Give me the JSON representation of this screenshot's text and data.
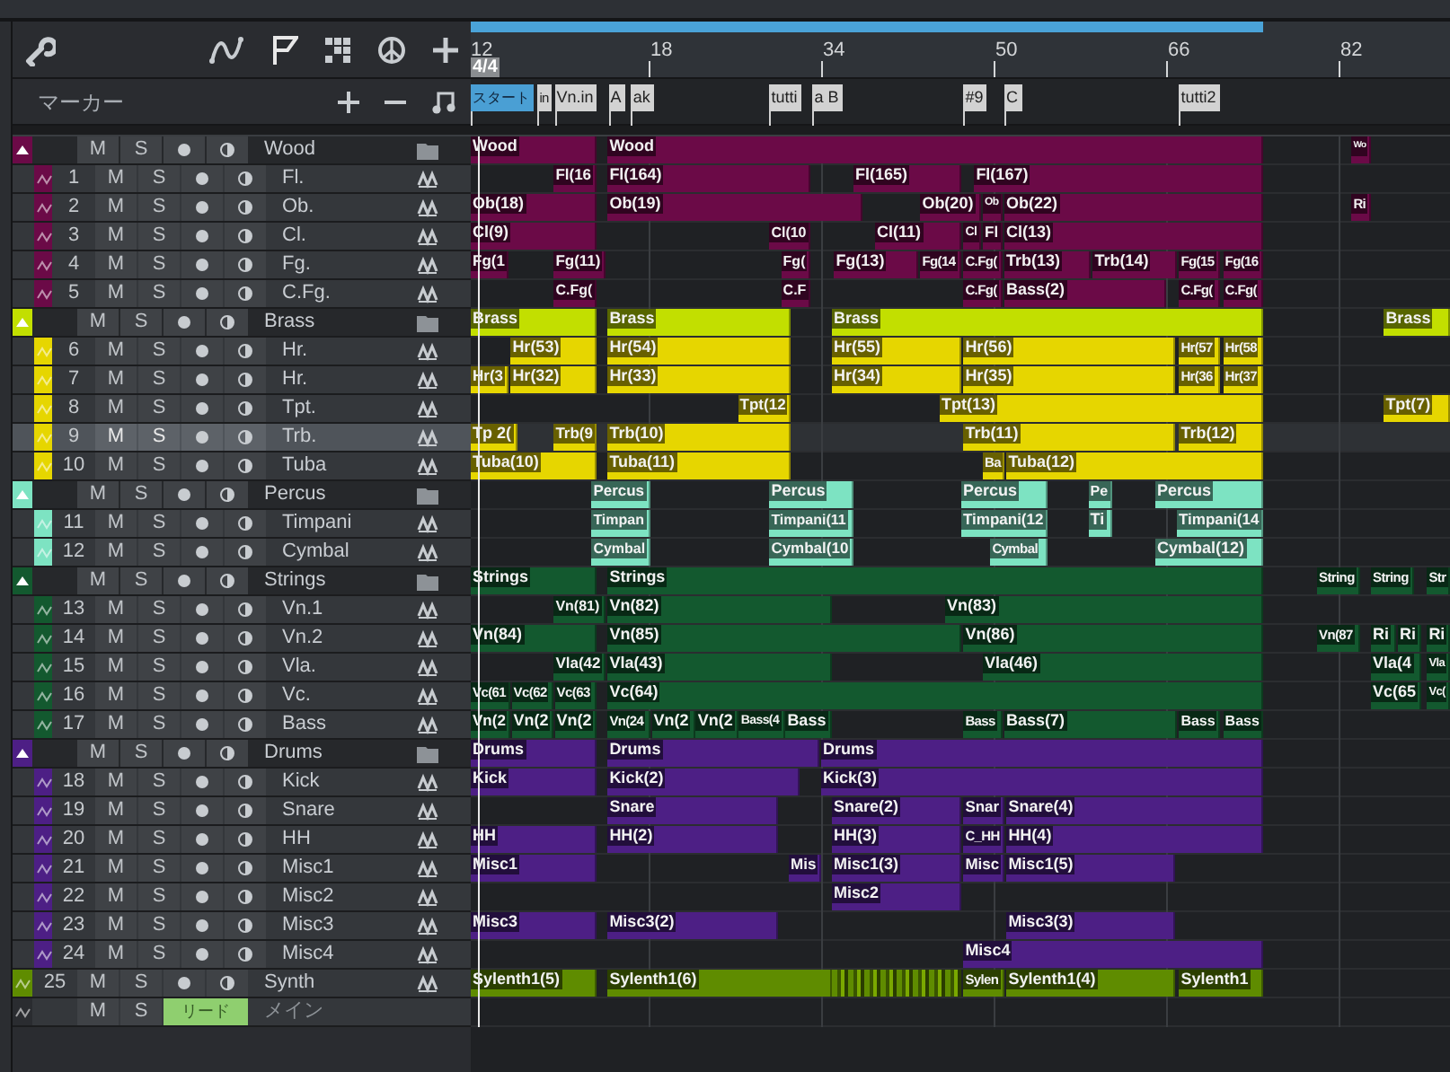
{
  "marker_panel": {
    "title": "マーカー"
  },
  "ruler": {
    "start_label": "12",
    "time_signature": "4/4",
    "ticks": [
      {
        "label": "18"
      },
      {
        "label": "34"
      },
      {
        "label": "50"
      },
      {
        "label": "66"
      },
      {
        "label": "82"
      }
    ]
  },
  "markers": [
    {
      "label": "スタート",
      "selected": true
    },
    {
      "label": "in",
      "selected": false
    },
    {
      "label": "Vn.in",
      "selected": false
    },
    {
      "label": "A",
      "selected": false
    },
    {
      "label": "ak",
      "selected": false
    },
    {
      "label": "tutti",
      "selected": false
    },
    {
      "label": "a B",
      "selected": false
    },
    {
      "label": "#9",
      "selected": false
    },
    {
      "label": "C",
      "selected": false
    },
    {
      "label": "tutti2",
      "selected": false
    }
  ],
  "tracks": [
    {
      "kind": "folder",
      "name": "Wood",
      "color": "#6b0a47",
      "expanded": true,
      "selected": false,
      "mute": "M",
      "solo": "S",
      "clips": [
        "Wood",
        "Wood",
        "Wo"
      ]
    },
    {
      "kind": "track",
      "number": "1",
      "name": "Fl.",
      "color": "#6b0a47",
      "selected": false,
      "mute": "M",
      "solo": "S",
      "clips": [
        "Fl(16",
        "Fl(164)",
        "Fl(165)",
        "Fl(167)"
      ]
    },
    {
      "kind": "track",
      "number": "2",
      "name": "Ob.",
      "color": "#6b0a47",
      "selected": false,
      "mute": "M",
      "solo": "S",
      "clips": [
        "Ob(18)",
        "Ob(19)",
        "Ob(20)",
        "Ob",
        "Ob(22)",
        "Ri"
      ]
    },
    {
      "kind": "track",
      "number": "3",
      "name": "Cl.",
      "color": "#6b0a47",
      "selected": false,
      "mute": "M",
      "solo": "S",
      "clips": [
        "Cl(9)",
        "Cl(10",
        "Cl(11)",
        "Cl",
        "Fl",
        "Cl(13)"
      ]
    },
    {
      "kind": "track",
      "number": "4",
      "name": "Fg.",
      "color": "#6b0a47",
      "selected": false,
      "mute": "M",
      "solo": "S",
      "clips": [
        "Fg(1",
        "Fg(11)",
        "Fg(",
        "Fg(13)",
        "Fg(14",
        "C.Fg(",
        "Trb(13)",
        "Trb(14)",
        "Fg(15",
        "Fg(16"
      ]
    },
    {
      "kind": "track",
      "number": "5",
      "name": "C.Fg.",
      "color": "#6b0a47",
      "selected": false,
      "mute": "M",
      "solo": "S",
      "clips": [
        "C.Fg(",
        "C.F",
        "C.Fg(",
        "Bass(2)",
        "C.Fg(",
        "C.Fg("
      ]
    },
    {
      "kind": "folder",
      "name": "Brass",
      "color": "#c2df00",
      "expanded": true,
      "selected": false,
      "mute": "M",
      "solo": "S",
      "clips": [
        "Brass",
        "Brass",
        "Brass",
        "Brass"
      ]
    },
    {
      "kind": "track",
      "number": "6",
      "name": "Hr.",
      "color": "#e6d600",
      "selected": false,
      "mute": "M",
      "solo": "S",
      "clips": [
        "Hr(53)",
        "Hr(54)",
        "Hr(55)",
        "Hr(56)",
        "Hr(57",
        "Hr(58"
      ]
    },
    {
      "kind": "track",
      "number": "7",
      "name": "Hr.",
      "color": "#e6d600",
      "selected": false,
      "mute": "M",
      "solo": "S",
      "clips": [
        "Hr(3",
        "Hr(32)",
        "Hr(33)",
        "Hr(34)",
        "Hr(35)",
        "Hr(36",
        "Hr(37"
      ]
    },
    {
      "kind": "track",
      "number": "8",
      "name": "Tpt.",
      "color": "#e6d600",
      "selected": false,
      "mute": "M",
      "solo": "S",
      "clips": [
        "Tpt(12",
        "Tpt(13)",
        "Tpt(7)"
      ]
    },
    {
      "kind": "track",
      "number": "9",
      "name": "Trb.",
      "color": "#e6d600",
      "selected": true,
      "mute": "M",
      "solo": "S",
      "clips": [
        "Tp 2(",
        "Trb(9",
        "Trb(10)",
        "Trb(11)",
        "Trb(12)"
      ]
    },
    {
      "kind": "track",
      "number": "10",
      "name": "Tuba",
      "color": "#e6d600",
      "selected": false,
      "mute": "M",
      "solo": "S",
      "clips": [
        "Tuba(10)",
        "Tuba(11)",
        "Ba",
        "Tuba(12)"
      ]
    },
    {
      "kind": "folder",
      "name": "Percus",
      "color": "#7de3c2",
      "expanded": true,
      "selected": false,
      "mute": "M",
      "solo": "S",
      "clips": [
        "Percus",
        "Percus",
        "Percus",
        "Pe",
        "Percus"
      ]
    },
    {
      "kind": "track",
      "number": "11",
      "name": "Timpani",
      "color": "#7de3c2",
      "selected": false,
      "mute": "M",
      "solo": "S",
      "clips": [
        "Timpan",
        "Timpani(11",
        "Timpani(12",
        "Ti",
        "Timpani(14"
      ]
    },
    {
      "kind": "track",
      "number": "12",
      "name": "Cymbal",
      "color": "#7de3c2",
      "selected": false,
      "mute": "M",
      "solo": "S",
      "clips": [
        "Cymbal",
        "Cymbal(10",
        "Cymbal",
        "Cymbal(12)"
      ]
    },
    {
      "kind": "folder",
      "name": "Strings",
      "color": "#13592f",
      "expanded": true,
      "selected": false,
      "mute": "M",
      "solo": "S",
      "clips": [
        "Strings",
        "Strings",
        "String",
        "String",
        "Str"
      ]
    },
    {
      "kind": "track",
      "number": "13",
      "name": "Vn.1",
      "color": "#13592f",
      "selected": false,
      "mute": "M",
      "solo": "S",
      "clips": [
        "Vn(81)",
        "Vn(82)",
        "Vn(83)"
      ]
    },
    {
      "kind": "track",
      "number": "14",
      "name": "Vn.2",
      "color": "#13592f",
      "selected": false,
      "mute": "M",
      "solo": "S",
      "clips": [
        "Vn(84)",
        "Vn(85)",
        "Vn(86)",
        "Vn(87",
        "Ri",
        "Ri",
        "Ri"
      ]
    },
    {
      "kind": "track",
      "number": "15",
      "name": "Vla.",
      "color": "#13592f",
      "selected": false,
      "mute": "M",
      "solo": "S",
      "clips": [
        "Vla(42",
        "Vla(43)",
        "Vla(46)",
        "Vla(4",
        "Vla"
      ]
    },
    {
      "kind": "track",
      "number": "16",
      "name": "Vc.",
      "color": "#13592f",
      "selected": false,
      "mute": "M",
      "solo": "S",
      "clips": [
        "Vc(61",
        "Vc(62",
        "Vc(63",
        "Vc(64)",
        "Vc(65",
        "Vc("
      ]
    },
    {
      "kind": "track",
      "number": "17",
      "name": "Bass",
      "color": "#13592f",
      "selected": false,
      "mute": "M",
      "solo": "S",
      "clips": [
        "Vn(2",
        "Vn(2",
        "Vn(2",
        "Vn(24",
        "Vn(2",
        "Vn(2",
        "Bass(4",
        "Bass",
        "Bass",
        "Bass(7)",
        "Bass",
        "Bass"
      ]
    },
    {
      "kind": "folder",
      "name": "Drums",
      "color": "#4d1f85",
      "expanded": true,
      "selected": false,
      "mute": "M",
      "solo": "S",
      "clips": [
        "Drums",
        "Drums",
        "Drums"
      ]
    },
    {
      "kind": "track",
      "number": "18",
      "name": "Kick",
      "color": "#4d1f85",
      "selected": false,
      "mute": "M",
      "solo": "S",
      "clips": [
        "Kick",
        "Kick(2)",
        "Kick(3)"
      ]
    },
    {
      "kind": "track",
      "number": "19",
      "name": "Snare",
      "color": "#4d1f85",
      "selected": false,
      "mute": "M",
      "solo": "S",
      "clips": [
        "Snare",
        "Snare(2)",
        "Snar",
        "Snare(4)"
      ]
    },
    {
      "kind": "track",
      "number": "20",
      "name": "HH",
      "color": "#4d1f85",
      "selected": false,
      "mute": "M",
      "solo": "S",
      "clips": [
        "HH",
        "HH(2)",
        "HH(3)",
        "C_HH",
        "HH(4)"
      ]
    },
    {
      "kind": "track",
      "number": "21",
      "name": "Misc1",
      "color": "#4d1f85",
      "selected": false,
      "mute": "M",
      "solo": "S",
      "clips": [
        "Misc1",
        "Mis",
        "Misc1(3)",
        "Misc",
        "Misc1(5)"
      ]
    },
    {
      "kind": "track",
      "number": "22",
      "name": "Misc2",
      "color": "#4d1f85",
      "selected": false,
      "mute": "M",
      "solo": "S",
      "clips": [
        "Misc2"
      ]
    },
    {
      "kind": "track",
      "number": "23",
      "name": "Misc3",
      "color": "#4d1f85",
      "selected": false,
      "mute": "M",
      "solo": "S",
      "clips": [
        "Misc3",
        "Misc3(2)",
        "Misc3(3)"
      ]
    },
    {
      "kind": "track",
      "number": "24",
      "name": "Misc4",
      "color": "#4d1f85",
      "selected": false,
      "mute": "M",
      "solo": "S",
      "clips": [
        "Misc4"
      ]
    },
    {
      "kind": "synth",
      "number": "25",
      "name": "Synth",
      "color": "#5f8c00",
      "selected": false,
      "mute": "M",
      "solo": "S",
      "clips": [
        "Sylenth1(5)",
        "Sylenth1(6)",
        "Sylen",
        "Sylenth1(4)",
        "Sylenth1"
      ]
    },
    {
      "kind": "bus",
      "name": "メイン",
      "output": "リード",
      "selected": false,
      "mute": "M",
      "solo": "S"
    }
  ]
}
